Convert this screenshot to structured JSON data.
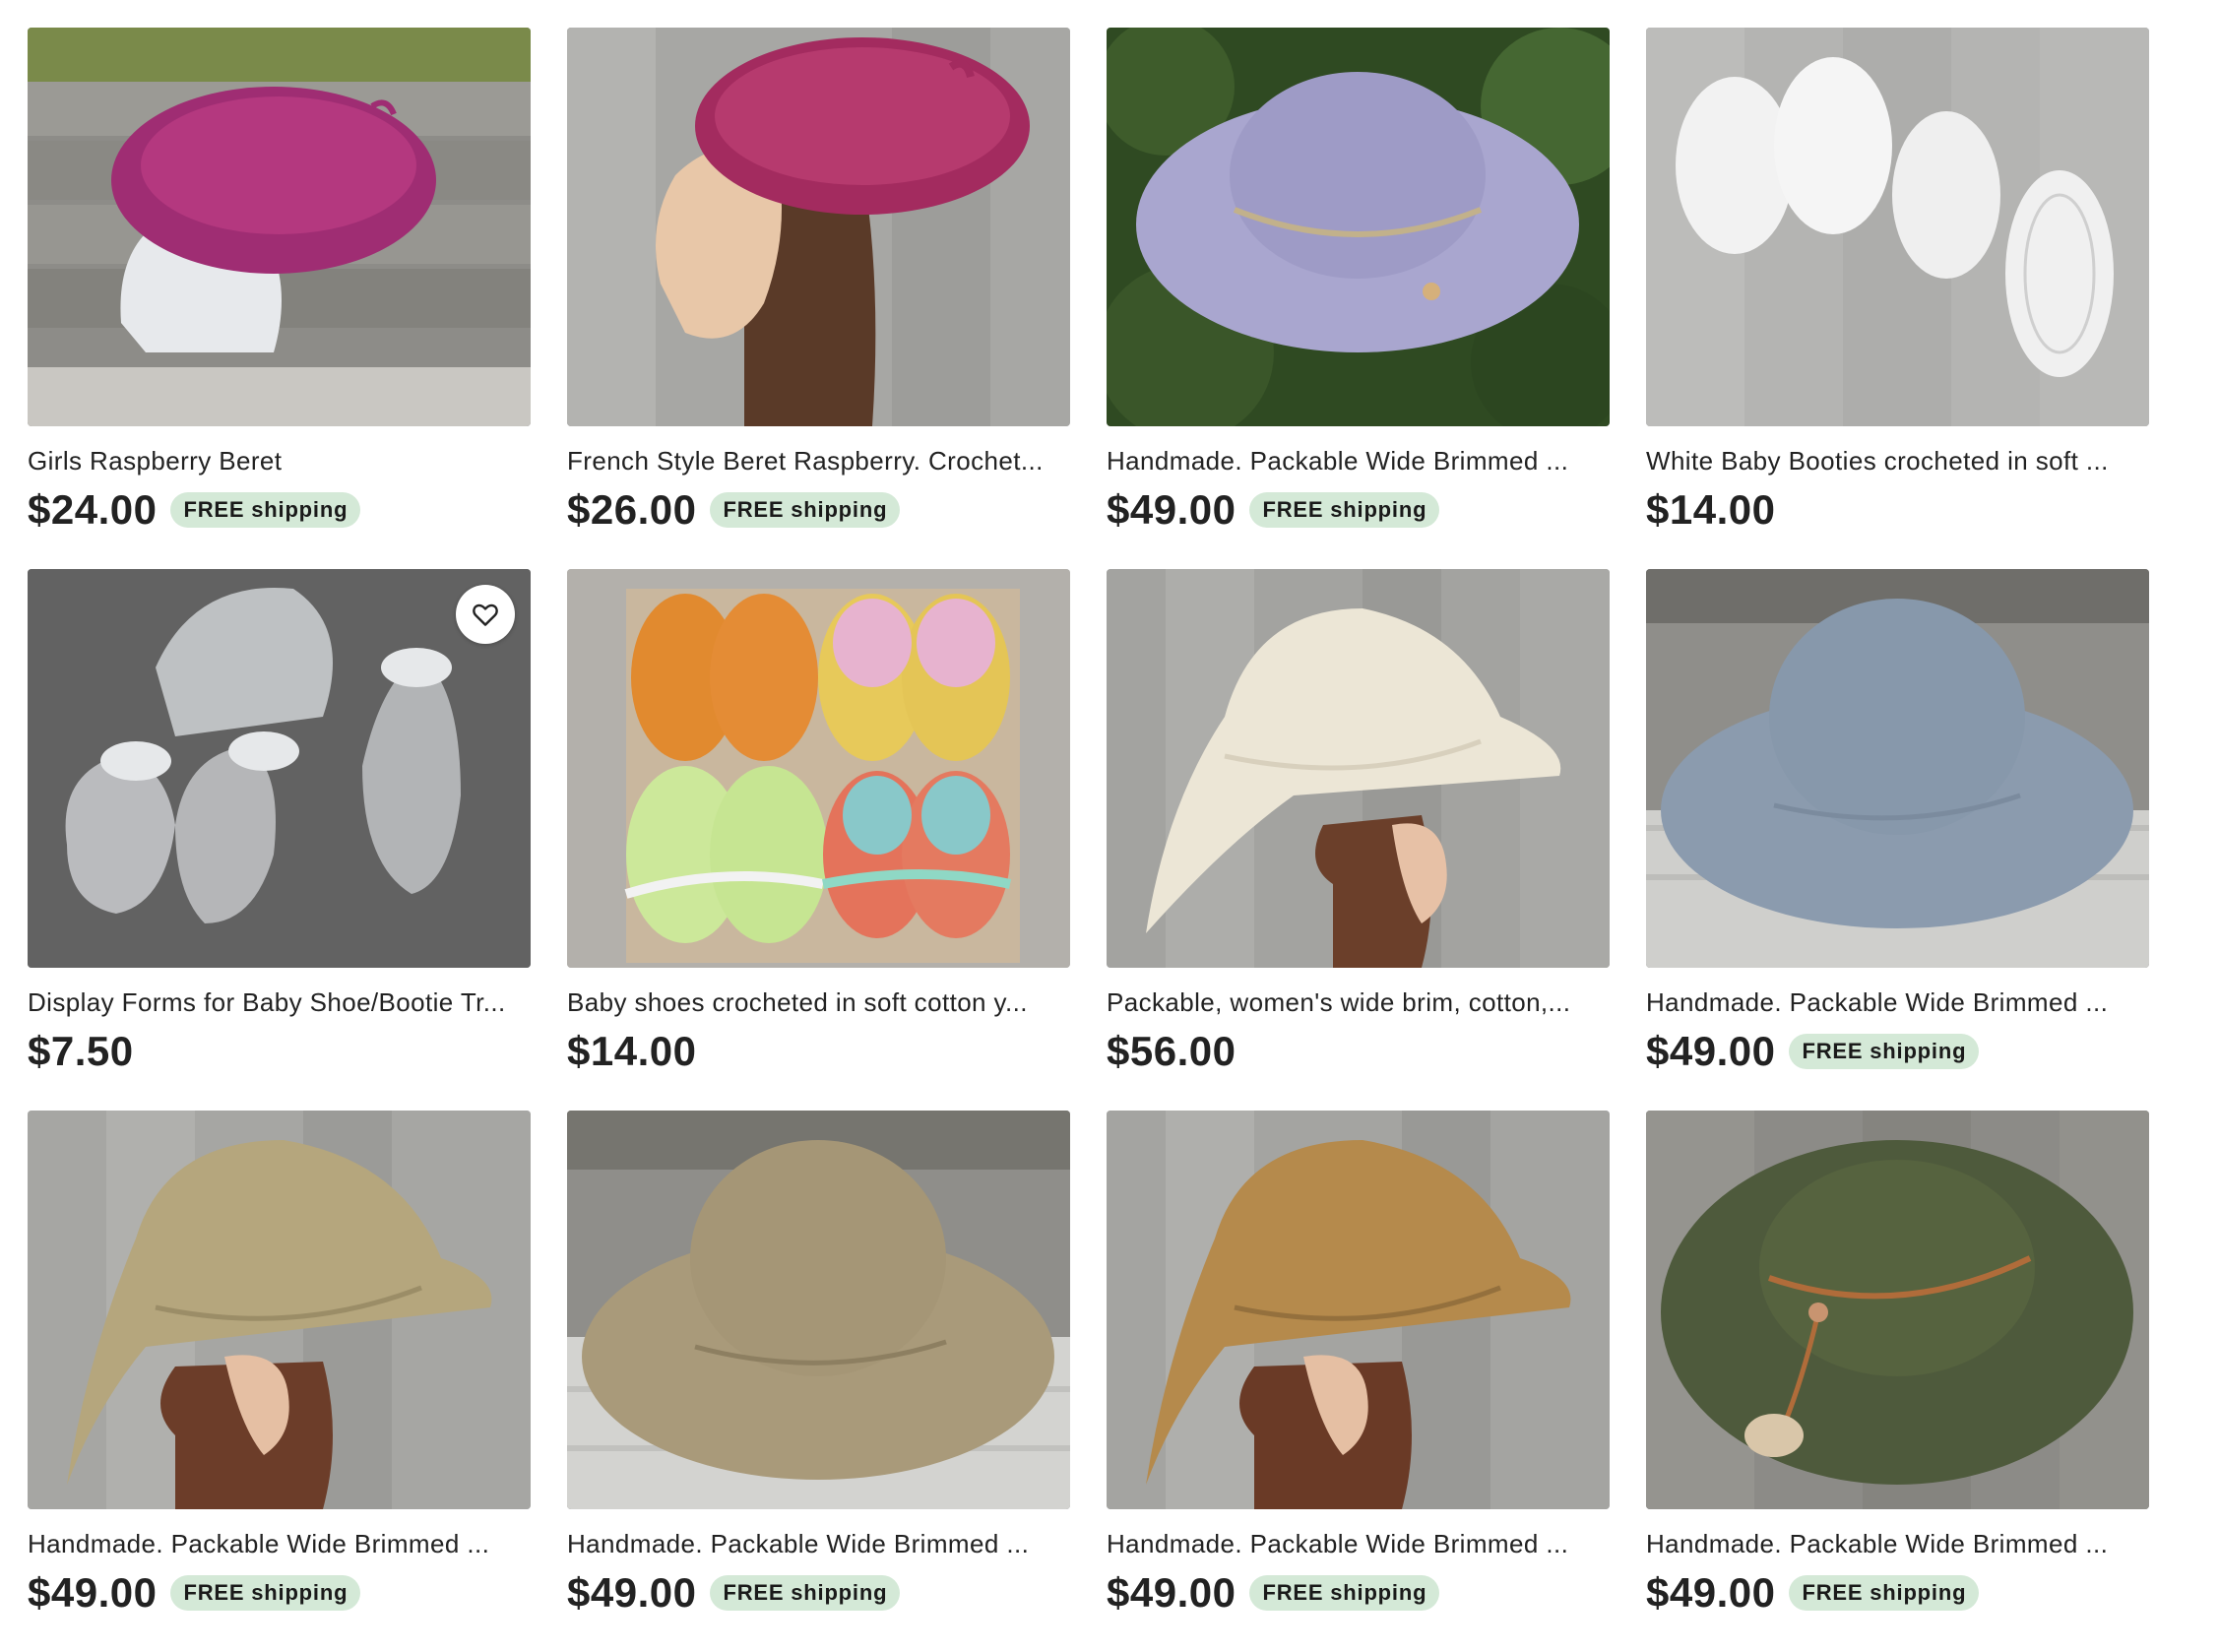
{
  "listings": [
    {
      "title": "Girls Raspberry Beret",
      "price": "$24.00",
      "badge": "FREE shipping",
      "image": "raspberry-beret-on-form-image"
    },
    {
      "title": "French Style Beret Raspberry. Crochet...",
      "price": "$26.00",
      "badge": "FREE shipping",
      "image": "raspberry-beret-on-mannequin-image"
    },
    {
      "title": "Handmade. Packable Wide Brimmed ...",
      "price": "$49.00",
      "badge": "FREE shipping",
      "image": "lavender-sun-hat-image"
    },
    {
      "title": "White Baby Booties crocheted in soft ...",
      "price": "$14.00",
      "badge": "",
      "image": "white-baby-booties-image"
    },
    {
      "title": "Display Forms for Baby Shoe/Bootie Tr...",
      "price": "$7.50",
      "badge": "",
      "image": "clear-bootie-forms-image",
      "favorite_icon": "heart-outline-icon"
    },
    {
      "title": "Baby shoes crocheted in soft cotton y...",
      "price": "$14.00",
      "badge": "",
      "image": "colorful-baby-shoes-image"
    },
    {
      "title": "Packable, women's wide brim, cotton,...",
      "price": "$56.00",
      "badge": "",
      "image": "cream-sun-hat-image"
    },
    {
      "title": "Handmade. Packable Wide Brimmed ...",
      "price": "$49.00",
      "badge": "FREE shipping",
      "image": "gray-sun-hat-image"
    },
    {
      "title": "Handmade. Packable Wide Brimmed ...",
      "price": "$49.00",
      "badge": "FREE shipping",
      "image": "khaki-sun-hat-on-mannequin-image"
    },
    {
      "title": "Handmade. Packable Wide Brimmed ...",
      "price": "$49.00",
      "badge": "FREE shipping",
      "image": "tan-sun-hat-image"
    },
    {
      "title": "Handmade. Packable Wide Brimmed ...",
      "price": "$49.00",
      "badge": "FREE shipping",
      "image": "mustard-sun-hat-on-mannequin-image"
    },
    {
      "title": "Handmade. Packable Wide Brimmed ...",
      "price": "$49.00",
      "badge": "FREE shipping",
      "image": "olive-sun-hat-image"
    }
  ],
  "colors": {
    "badge_bg": "#d4e9d7",
    "price_text": "#222222",
    "raspberry": "#a8316f",
    "lavender": "#a7a4cc",
    "cream": "#ece6d6",
    "gray_hat": "#8b9bae",
    "khaki": "#b5a67d",
    "tan": "#a99a7a",
    "mustard": "#b58a4c",
    "olive": "#4e5a3c"
  }
}
